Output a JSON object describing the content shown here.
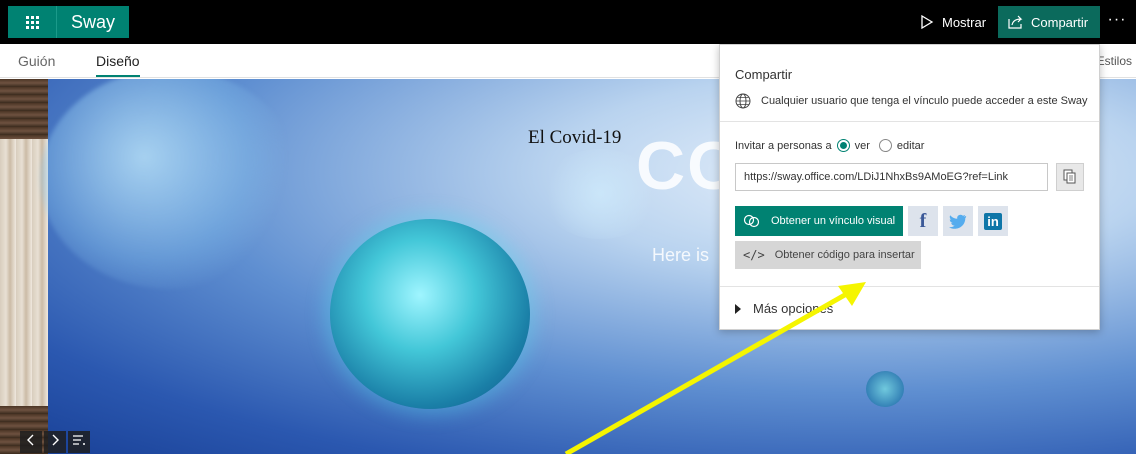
{
  "titlebar": {
    "app_name": "Sway",
    "mostrar_label": "Mostrar",
    "compartir_label": "Compartir",
    "more_label": "···",
    "waffle_icon": "app-launcher-icon",
    "mostrar_icon": "play-icon",
    "compartir_icon": "share-icon"
  },
  "tabs": [
    {
      "label": "Guión"
    },
    {
      "label": "Diseño"
    }
  ],
  "styles_label": "Estilos",
  "slide": {
    "title": "El Covid-19",
    "big_text": "CO",
    "subtitle": "Here is"
  },
  "share_panel": {
    "heading": "Compartir",
    "access_text": "Cualquier usuario que tenga el vínculo puede acceder a este Sway",
    "invite_label": "Invitar a personas a",
    "option_view": "ver",
    "option_edit": "editar",
    "selected_option": "ver",
    "link_url": "https://sway.office.com/LDiJ1NhxBs9AMoEG?ref=Link",
    "visual_link_label": "Obtener un vínculo visual",
    "embed_label": "Obtener código para insertar",
    "more_options_label": "Más opciones",
    "social": [
      "Facebook",
      "Twitter",
      "LinkedIn"
    ]
  },
  "nav": {
    "prev_icon": "chevron-left-icon",
    "next_icon": "chevron-right-icon",
    "nav_icon": "navigation-icon"
  },
  "colors": {
    "accent": "#008272",
    "arrow": "#f5f500",
    "titlebar": "#000000"
  }
}
